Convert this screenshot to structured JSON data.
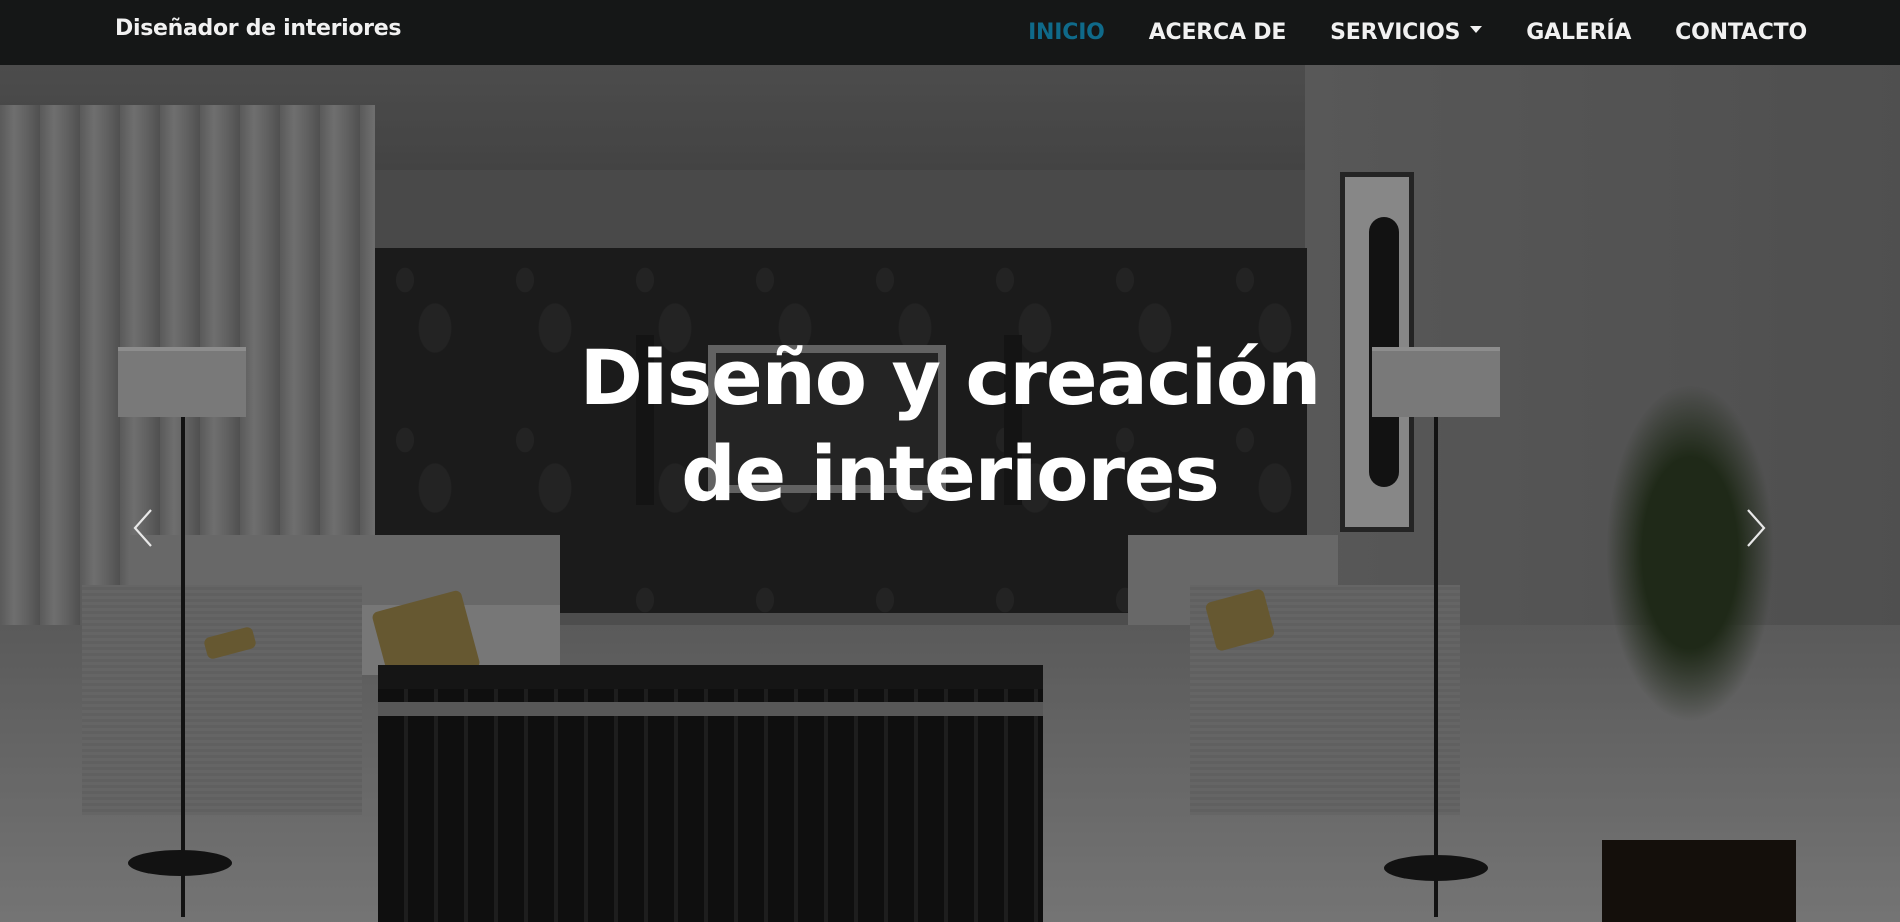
{
  "navbar": {
    "brand": "Diseñador de interiores",
    "items": [
      {
        "label": "INICIO",
        "active": true
      },
      {
        "label": "ACERCA DE",
        "active": false
      },
      {
        "label": "SERVICIOS",
        "active": false,
        "dropdown": true
      },
      {
        "label": "GALERÍA",
        "active": false
      },
      {
        "label": "CONTACTO",
        "active": false
      }
    ]
  },
  "hero": {
    "title": "Diseño y creación de interiores",
    "image_alt": "living-room-interior",
    "prev_icon": "chevron-left-icon",
    "next_icon": "chevron-right-icon"
  },
  "colors": {
    "navbar_bg": "#151717",
    "nav_text": "#f1f1f1",
    "nav_active": "#0f6a8a",
    "hero_text": "#ffffff"
  }
}
